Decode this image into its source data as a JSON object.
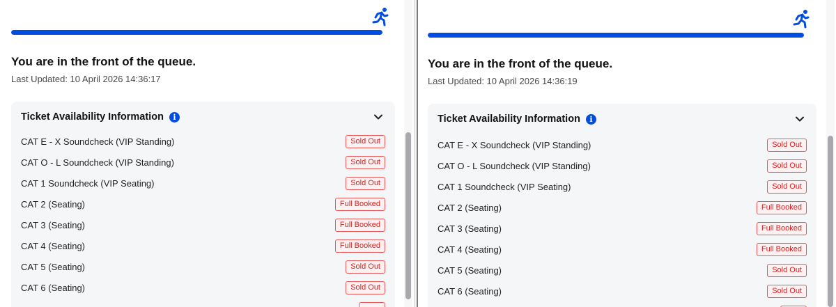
{
  "colors": {
    "accent": "#024ddf",
    "sold_out": "#d92020",
    "card_bg": "#f5f6f8"
  },
  "panes": [
    {
      "progress_pct": 100,
      "queue_title": "You are in the front of the queue.",
      "last_updated": "Last Updated: 10 April 2026 14:36:17",
      "card_title": "Ticket Availability Information",
      "info_icon": "i",
      "rows": [
        {
          "label": "CAT E - X Soundcheck (VIP Standing)",
          "status": "Sold Out"
        },
        {
          "label": "CAT O - L Soundcheck (VIP Standing)",
          "status": "Sold Out"
        },
        {
          "label": "CAT 1 Soundcheck (VIP Seating)",
          "status": "Sold Out"
        },
        {
          "label": "CAT 2 (Seating)",
          "status": "Full Booked"
        },
        {
          "label": "CAT 3 (Seating)",
          "status": "Full Booked"
        },
        {
          "label": "CAT 4 (Seating)",
          "status": "Full Booked"
        },
        {
          "label": "CAT 5 (Seating)",
          "status": "Sold Out"
        },
        {
          "label": "CAT 6 (Seating)",
          "status": "Sold Out"
        }
      ]
    },
    {
      "progress_pct": 100,
      "queue_title": "You are in the front of the queue.",
      "last_updated": "Last Updated: 10 April 2026 14:36:19",
      "card_title": "Ticket Availability Information",
      "info_icon": "i",
      "rows": [
        {
          "label": "CAT E - X Soundcheck (VIP Standing)",
          "status": "Sold Out"
        },
        {
          "label": "CAT O - L Soundcheck (VIP Standing)",
          "status": "Sold Out"
        },
        {
          "label": "CAT 1 Soundcheck (VIP Seating)",
          "status": "Sold Out"
        },
        {
          "label": "CAT 2 (Seating)",
          "status": "Full Booked"
        },
        {
          "label": "CAT 3 (Seating)",
          "status": "Full Booked"
        },
        {
          "label": "CAT 4 (Seating)",
          "status": "Full Booked"
        },
        {
          "label": "CAT 5 (Seating)",
          "status": "Sold Out"
        },
        {
          "label": "CAT 6 (Seating)",
          "status": "Sold Out"
        }
      ]
    }
  ]
}
